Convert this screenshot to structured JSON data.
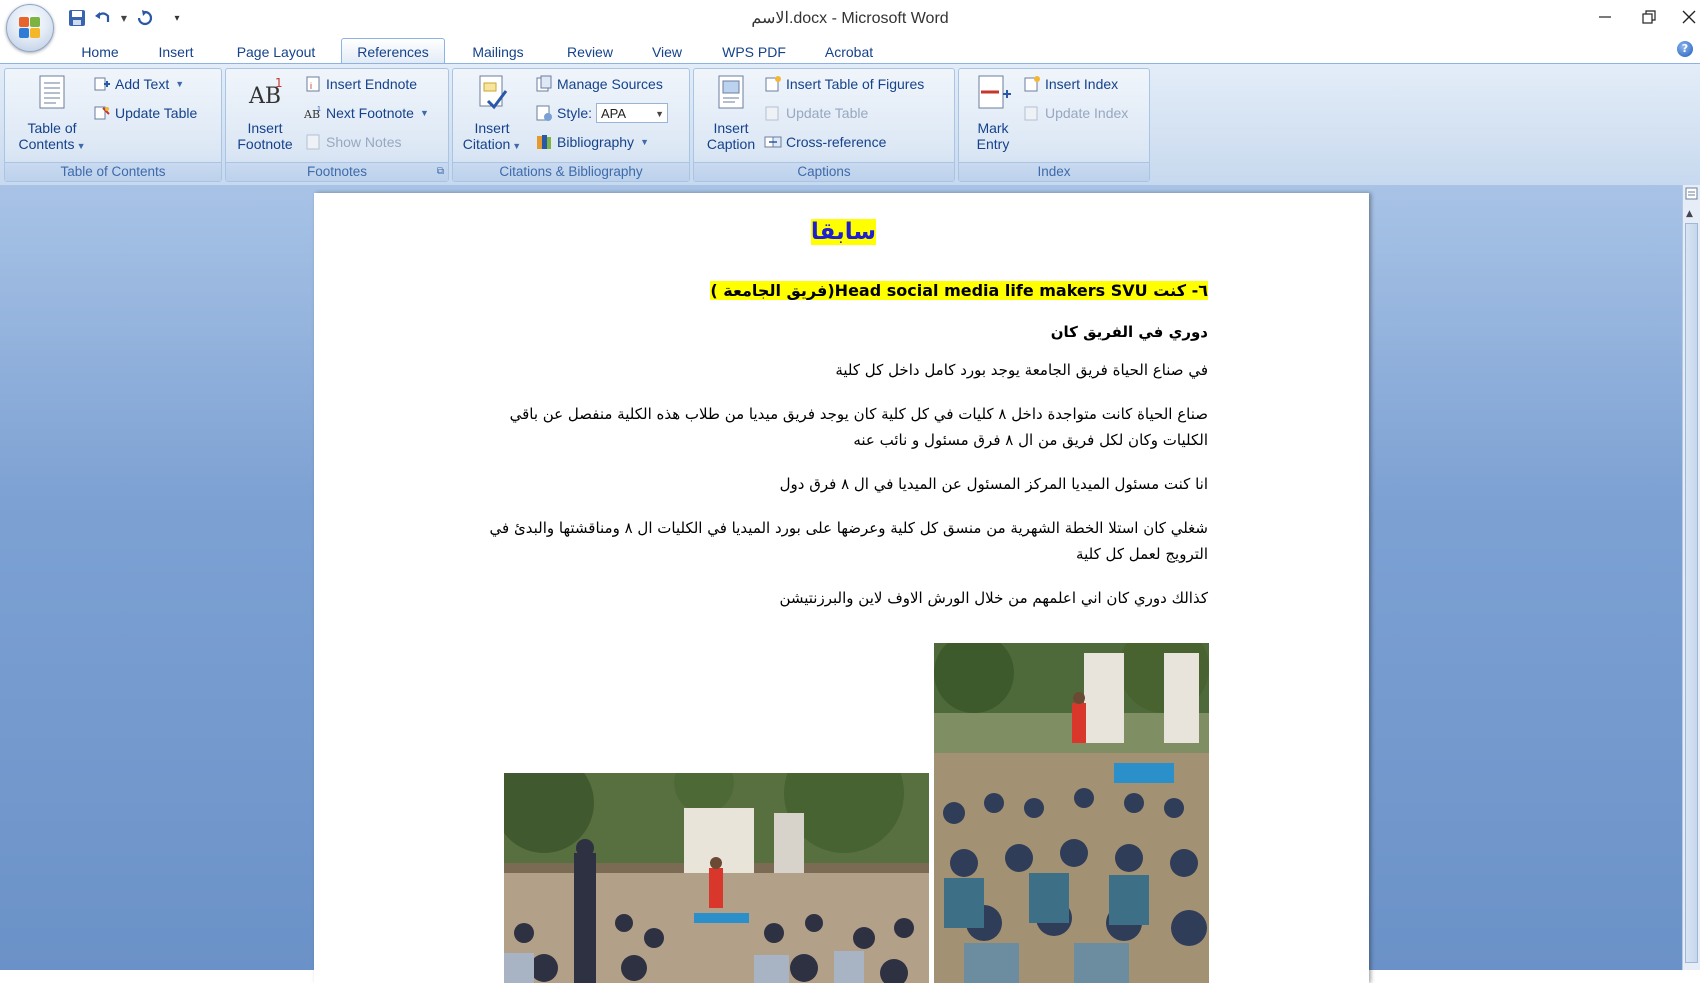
{
  "window": {
    "title": "الاسم.docx - Microsoft Word",
    "controls": [
      "minimize-icon",
      "restore-icon",
      "close-icon"
    ]
  },
  "quick_access": [
    "save-icon",
    "undo-icon",
    "redo-icon",
    "customize-icon"
  ],
  "tabs": [
    {
      "label": "Home"
    },
    {
      "label": "Insert"
    },
    {
      "label": "Page Layout"
    },
    {
      "label": "References",
      "active": true
    },
    {
      "label": "Mailings"
    },
    {
      "label": "Review"
    },
    {
      "label": "View"
    },
    {
      "label": "WPS PDF"
    },
    {
      "label": "Acrobat"
    }
  ],
  "ribbon": {
    "toc": {
      "label": "Table of Contents",
      "table_of_contents_btn": [
        "Table of",
        "Contents"
      ],
      "add_text": "Add Text",
      "update_table": "Update Table"
    },
    "footnotes": {
      "label": "Footnotes",
      "insert_footnote": [
        "Insert",
        "Footnote"
      ],
      "insert_endnote": "Insert Endnote",
      "next_footnote": "Next Footnote",
      "show_notes": "Show Notes"
    },
    "citations": {
      "label": "Citations & Bibliography",
      "insert_citation": [
        "Insert",
        "Citation"
      ],
      "manage_sources": "Manage Sources",
      "style_label": "Style:",
      "style_value": "APA",
      "bibliography": "Bibliography"
    },
    "captions": {
      "label": "Captions",
      "insert_caption": [
        "Insert",
        "Caption"
      ],
      "insert_table_of_figures": "Insert Table of Figures",
      "update_table": "Update Table",
      "cross_reference": "Cross-reference"
    },
    "index": {
      "label": "Index",
      "mark_entry": [
        "Mark",
        "Entry"
      ],
      "insert_index": "Insert Index",
      "update_index": "Update Index"
    }
  },
  "document": {
    "heading": "سابقا",
    "role_line": "٦- كنت  Head social media life makers SVU(فريق الجامعة )",
    "subheading": "دوري في  الفريق كان",
    "paragraphs": [
      "في صناع الحياة فريق الجامعة يوجد بورد كامل داخل كل كلية",
      "صناع الحياة كانت متواجدة داخل ٨ كليات في كل كلية كان يوجد فريق ميديا من طلاب هذه الكلية  منفصل عن باقي الكليات وكان لكل فريق من ال ٨ فرق مسئول و نائب عنه",
      "انا كنت مسئول الميديا المركز المسئول عن الميديا في ال ٨ فرق دول",
      "شغلي كان استلا الخطة الشهرية من منسق كل كلية وعرضها على بورد الميديا في الكليات ال ٨ ومناقشتها والبدئ في الترويج لعمل كل كلية",
      "كذالك دوري كان اني اعلمهم من خلال الورش الاوف لاين والبرزنتيشن"
    ]
  },
  "colors": {
    "ribbon_text": "#15428b",
    "highlight": "#ffff00",
    "heading_blue": "#1f1fcf",
    "workspace_blue": "#7da1d3"
  }
}
